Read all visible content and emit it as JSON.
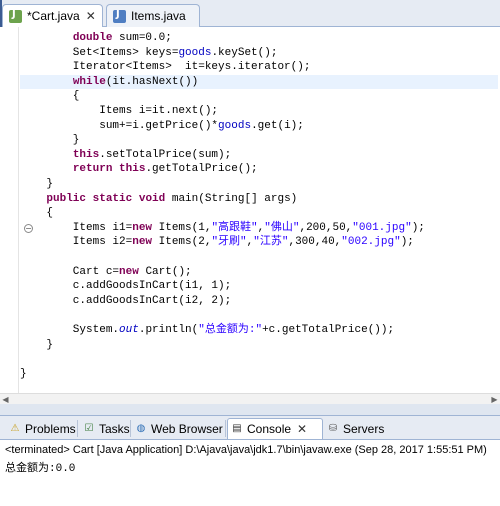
{
  "editor_tabs": [
    {
      "label": "*Cart.java",
      "close": "✕",
      "active": true
    },
    {
      "label": "Items.java",
      "active": false
    }
  ],
  "code_lines": [
    "        double sum=0.0;",
    "        Set<Items> keys=goods.keySet();",
    "        Iterator<Items>  it=keys.iterator();",
    "        while(it.hasNext())",
    "        {",
    "            Items i=it.next();",
    "            sum+=i.getPrice()*goods.get(i);",
    "        }",
    "        this.setTotalPrice(sum);",
    "        return this.getTotalPrice();",
    "    }",
    "    public static void main(String[] args)",
    "    {",
    "        Items i1=new Items(1,\"高跟鞋\",\"佛山\",200,50,\"001.jpg\");",
    "        Items i2=new Items(2,\"牙刷\",\"江苏\",300,40,\"002.jpg\");",
    "",
    "        Cart c=new Cart();",
    "        c.addGoodsInCart(i1, 1);",
    "        c.addGoodsInCart(i2, 2);",
    "",
    "        System.out.println(\"总金额为:\"+c.getTotalPrice());",
    "    }",
    "",
    "}"
  ],
  "highlighted_line_index": 3,
  "console_tabs": [
    {
      "label": "Problems",
      "icon": "problems-icon",
      "active": false
    },
    {
      "label": "Tasks",
      "icon": "tasks-icon",
      "active": false
    },
    {
      "label": "Web Browser",
      "icon": "globe-icon",
      "active": false
    },
    {
      "label": "Console",
      "icon": "console-icon",
      "close": "✕",
      "active": true
    },
    {
      "label": "Servers",
      "icon": "servers-icon",
      "active": false
    }
  ],
  "console": {
    "header": "<terminated> Cart [Java Application] D:\\Ajava\\java\\jdk1.7\\bin\\javaw.exe (Sep 28, 2017 1:55:51 PM)",
    "output": "总金额为:0.0"
  },
  "colors": {
    "keyword": "#7f0055",
    "field": "#0000c0",
    "string": "#2a00ff",
    "highlight": "#e8f2fe"
  }
}
